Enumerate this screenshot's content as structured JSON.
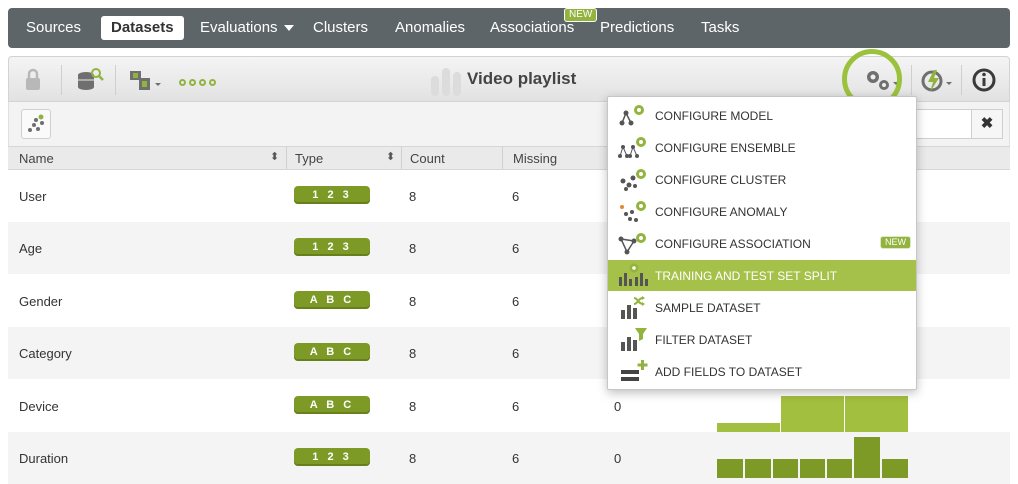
{
  "nav": {
    "items": [
      {
        "label": "Sources"
      },
      {
        "label": "Datasets"
      },
      {
        "label": "Evaluations"
      },
      {
        "label": "Clusters"
      },
      {
        "label": "Anomalies"
      },
      {
        "label": "Associations"
      },
      {
        "label": "Predictions"
      },
      {
        "label": "Tasks"
      }
    ],
    "associations_badge": "NEW"
  },
  "toolbar": {
    "title": "Video playlist",
    "icons": [
      "lock-icon",
      "database-search-icon",
      "dataset-type-icon",
      "progress-dots-icon",
      "dataset-bars-icon",
      "gears-icon",
      "one-click-icon",
      "info-icon"
    ]
  },
  "table": {
    "headers": [
      "Name",
      "Type",
      "Count",
      "Missing"
    ],
    "rows": [
      {
        "name": "User",
        "type": "1 2 3",
        "count": "8",
        "missing": "6",
        "errors": ""
      },
      {
        "name": "Age",
        "type": "1 2 3",
        "count": "8",
        "missing": "6",
        "errors": ""
      },
      {
        "name": "Gender",
        "type": "A B C",
        "count": "8",
        "missing": "6",
        "errors": ""
      },
      {
        "name": "Category",
        "type": "A B C",
        "count": "8",
        "missing": "6",
        "errors": ""
      },
      {
        "name": "Device",
        "type": "A B C",
        "count": "8",
        "missing": "6",
        "errors": "0"
      },
      {
        "name": "Duration",
        "type": "1 2 3",
        "count": "8",
        "missing": "6",
        "errors": "0"
      }
    ]
  },
  "menu": {
    "items": [
      {
        "label": "CONFIGURE MODEL",
        "icon": "model-gear-icon"
      },
      {
        "label": "CONFIGURE ENSEMBLE",
        "icon": "ensemble-gear-icon"
      },
      {
        "label": "CONFIGURE CLUSTER",
        "icon": "cluster-gear-icon"
      },
      {
        "label": "CONFIGURE ANOMALY",
        "icon": "anomaly-gear-icon"
      },
      {
        "label": "CONFIGURE ASSOCIATION",
        "icon": "association-gear-icon",
        "badge": "NEW"
      },
      {
        "label": "TRAINING AND TEST SET SPLIT",
        "icon": "split-icon",
        "highlighted": true
      },
      {
        "label": "SAMPLE DATASET",
        "icon": "sample-icon"
      },
      {
        "label": "FILTER DATASET",
        "icon": "filter-icon"
      },
      {
        "label": "ADD FIELDS TO DATASET",
        "icon": "add-fields-icon"
      }
    ]
  },
  "colors": {
    "accent": "#92b33d",
    "highlight": "#a6c14a",
    "nav": "#5e6569"
  }
}
